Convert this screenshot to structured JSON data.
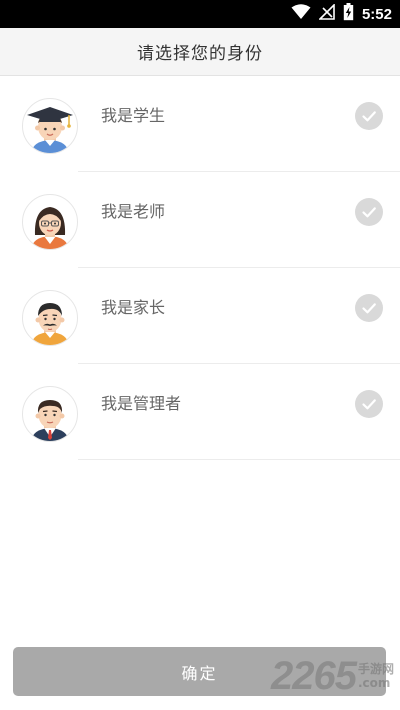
{
  "status_bar": {
    "time": "5:52",
    "icons": [
      "wifi-icon",
      "no-signal-icon",
      "battery-charging-icon"
    ]
  },
  "header": {
    "title": "请选择您的身份"
  },
  "roles": [
    {
      "label": "我是学生",
      "avatar": "student-avatar",
      "selected": false
    },
    {
      "label": "我是老师",
      "avatar": "teacher-avatar",
      "selected": false
    },
    {
      "label": "我是家长",
      "avatar": "parent-avatar",
      "selected": false
    },
    {
      "label": "我是管理者",
      "avatar": "manager-avatar",
      "selected": false
    }
  ],
  "confirm": {
    "label": "确定"
  },
  "watermark": {
    "number": "2265",
    "suffix": "手游网",
    "domain": ".com"
  },
  "colors": {
    "header_bg": "#f5f5f5",
    "check_bg": "#d9d9d9",
    "button_bg": "#a9a9a9",
    "label_text": "#666666"
  }
}
